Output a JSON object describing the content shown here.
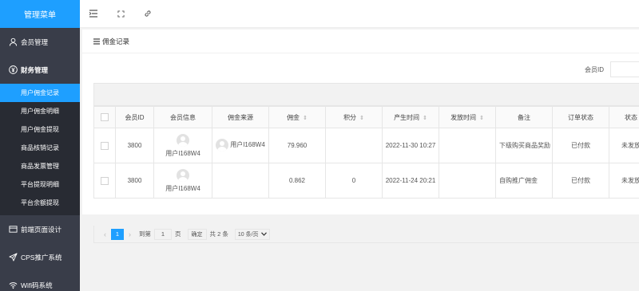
{
  "sidebar": {
    "title": "管理菜单",
    "groups": [
      {
        "label": "会员管理",
        "icon": "user-icon"
      },
      {
        "label": "财务管理",
        "icon": "yen-icon"
      }
    ],
    "finance_items": [
      {
        "label": "用户佣金记录",
        "active": true
      },
      {
        "label": "用户佣金明细",
        "active": false
      },
      {
        "label": "用户佣金提现",
        "active": false
      },
      {
        "label": "商品核销记录",
        "active": false
      },
      {
        "label": "商品发票管理",
        "active": false
      },
      {
        "label": "平台提现明细",
        "active": false
      },
      {
        "label": "平台余额提现",
        "active": false
      }
    ],
    "bottom_groups": [
      {
        "label": "前端页面设计",
        "icon": "layout-icon"
      },
      {
        "label": "CPS推广系统",
        "icon": "send-icon"
      },
      {
        "label": "Wifi码系统",
        "icon": "wifi-icon"
      }
    ]
  },
  "topbar": {
    "icons": [
      "collapse-menu-icon",
      "fullscreen-icon",
      "link-icon"
    ]
  },
  "card": {
    "title": "佣金记录"
  },
  "filter": {
    "member_id_label": "会员ID",
    "member_id_value": ""
  },
  "table": {
    "columns": [
      "会员ID",
      "会员信息",
      "佣金来源",
      "佣金",
      "积分",
      "产生时间",
      "发放时间",
      "备注",
      "订单状态",
      "状态"
    ],
    "sortable": [
      false,
      false,
      false,
      true,
      true,
      true,
      true,
      false,
      false,
      false
    ],
    "rows": [
      {
        "member_id": "3800",
        "member_info": "用户I168W4",
        "source": "用户I168W4",
        "commission": "79.960",
        "points": "",
        "created": "2022-11-30 10:27",
        "issued": "",
        "remark": "下级购买商品奖励",
        "order_status": "已付款",
        "status": "未发放"
      },
      {
        "member_id": "3800",
        "member_info": "用户I168W4",
        "source": "",
        "commission": "0.862",
        "points": "0",
        "created": "2022-11-24 20:21",
        "issued": "",
        "remark": "自购推广佣金",
        "order_status": "已付款",
        "status": "未发放"
      }
    ]
  },
  "pager": {
    "current": "1",
    "goto_label": "到第",
    "page_input": "1",
    "page_unit": "页",
    "confirm": "确定",
    "total": "共 2 条",
    "page_size": "10 条/页"
  },
  "colors": {
    "accent": "#1e9fff",
    "sidebar": "#393d49",
    "paid": "#5fb878",
    "unpaid": "#ff5722"
  }
}
